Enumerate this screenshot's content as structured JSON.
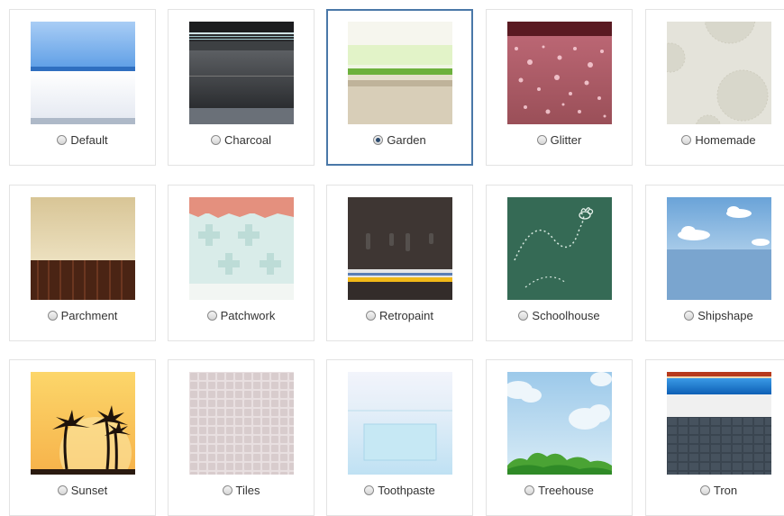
{
  "themes": [
    {
      "name": "Default",
      "selected": false,
      "thumb_icon": "default-theme-preview"
    },
    {
      "name": "Charcoal",
      "selected": false,
      "thumb_icon": "charcoal-theme-preview"
    },
    {
      "name": "Garden",
      "selected": true,
      "thumb_icon": "garden-theme-preview"
    },
    {
      "name": "Glitter",
      "selected": false,
      "thumb_icon": "glitter-theme-preview"
    },
    {
      "name": "Homemade",
      "selected": false,
      "thumb_icon": "homemade-theme-preview"
    },
    {
      "name": "Parchment",
      "selected": false,
      "thumb_icon": "parchment-theme-preview"
    },
    {
      "name": "Patchwork",
      "selected": false,
      "thumb_icon": "patchwork-theme-preview"
    },
    {
      "name": "Retropaint",
      "selected": false,
      "thumb_icon": "retropaint-theme-preview"
    },
    {
      "name": "Schoolhouse",
      "selected": false,
      "thumb_icon": "schoolhouse-theme-preview"
    },
    {
      "name": "Shipshape",
      "selected": false,
      "thumb_icon": "shipshape-theme-preview"
    },
    {
      "name": "Sunset",
      "selected": false,
      "thumb_icon": "sunset-theme-preview"
    },
    {
      "name": "Tiles",
      "selected": false,
      "thumb_icon": "tiles-theme-preview"
    },
    {
      "name": "Toothpaste",
      "selected": false,
      "thumb_icon": "toothpaste-theme-preview"
    },
    {
      "name": "Treehouse",
      "selected": false,
      "thumb_icon": "treehouse-theme-preview"
    },
    {
      "name": "Tron",
      "selected": false,
      "thumb_icon": "tron-theme-preview"
    }
  ],
  "colors": {
    "selected_border": "#4a78a8",
    "card_border": "#e3e3e3",
    "label_text": "#333333"
  }
}
